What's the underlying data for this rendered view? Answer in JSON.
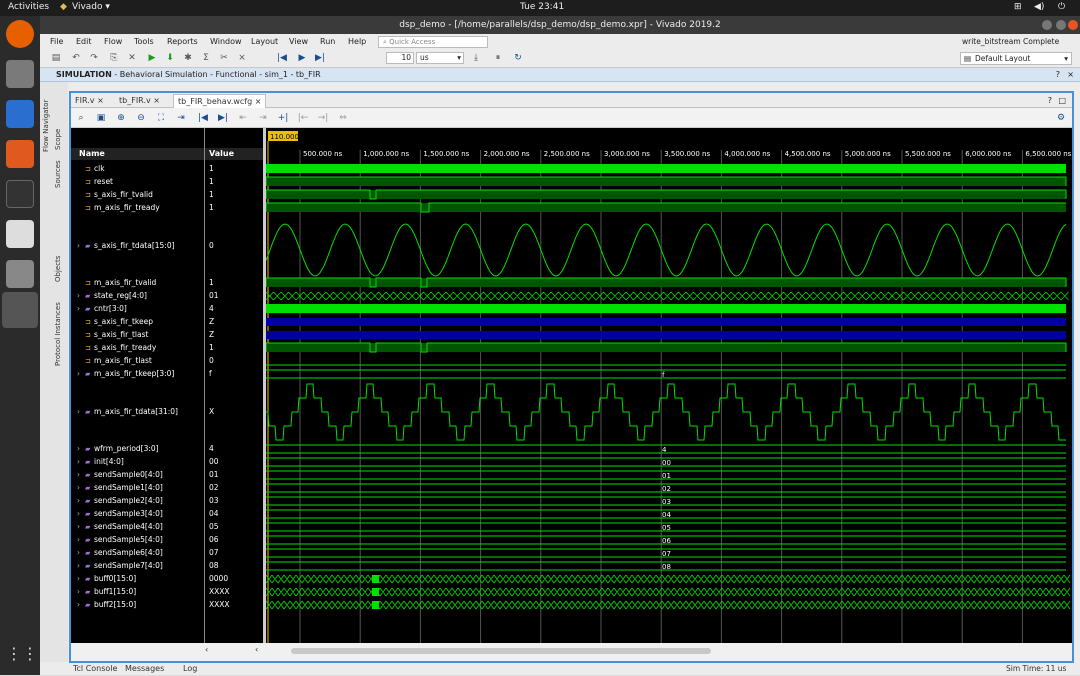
{
  "topbar": {
    "activities": "Activities",
    "app": "Vivado ▾",
    "clock": "Tue 23:41"
  },
  "window": {
    "title": "dsp_demo - [/home/parallels/dsp_demo/dsp_demo.xpr] - Vivado 2019.2"
  },
  "menu": [
    "File",
    "Edit",
    "Flow",
    "Tools",
    "Reports",
    "Window",
    "Layout",
    "View",
    "Run",
    "Help"
  ],
  "quick_access": "Quick Access",
  "toolbar": {
    "run_value": "10",
    "run_unit": "us",
    "status": "write_bitstream Complete",
    "layout": "Default Layout"
  },
  "simbar": {
    "label": "SIMULATION",
    "detail": " - Behavioral Simulation - Functional - sim_1 - tb_FIR"
  },
  "side_tabs": [
    "Flow Navigator",
    "Scope",
    "Sources",
    "Objects",
    "Protocol Instances"
  ],
  "tabs": [
    "FIR.v",
    "tb_FIR.v",
    "tb_FIR_behav.wcfg"
  ],
  "cursor_time": "110.000",
  "columns": {
    "name": "Name",
    "value": "Value"
  },
  "time_ticks": [
    "500.000 ns",
    "1,000.000 ns",
    "1,500.000 ns",
    "2,000.000 ns",
    "2,500.000 ns",
    "3,000.000 ns",
    "3,500.000 ns",
    "4,000.000 ns",
    "4,500.000 ns",
    "5,000.000 ns",
    "5,500.000 ns",
    "6,000.000 ns",
    "6,500.000 ns"
  ],
  "signals": [
    {
      "name": "clk",
      "value": "1",
      "kind": "bit",
      "expand": false
    },
    {
      "name": "reset",
      "value": "1",
      "kind": "bit",
      "expand": false
    },
    {
      "name": "s_axis_fir_tvalid",
      "value": "1",
      "kind": "bit",
      "expand": false
    },
    {
      "name": "m_axis_fir_tready",
      "value": "1",
      "kind": "bit",
      "expand": false
    },
    {
      "name": "s_axis_fir_tdata[15:0]",
      "value": "0",
      "kind": "analog",
      "expand": true
    },
    {
      "name": "m_axis_fir_tvalid",
      "value": "1",
      "kind": "bit",
      "expand": false
    },
    {
      "name": "state_reg[4:0]",
      "value": "01",
      "kind": "bus",
      "expand": true
    },
    {
      "name": "cntr[3:0]",
      "value": "4",
      "kind": "bus",
      "expand": true
    },
    {
      "name": "s_axis_fir_tkeep",
      "value": "Z",
      "kind": "bit",
      "expand": false
    },
    {
      "name": "s_axis_fir_tlast",
      "value": "Z",
      "kind": "bit",
      "expand": false
    },
    {
      "name": "s_axis_fir_tready",
      "value": "1",
      "kind": "bit",
      "expand": false
    },
    {
      "name": "m_axis_fir_tlast",
      "value": "0",
      "kind": "bit",
      "expand": false
    },
    {
      "name": "m_axis_fir_tkeep[3:0]",
      "value": "f",
      "kind": "bus",
      "expand": true
    },
    {
      "name": "m_axis_fir_tdata[31:0]",
      "value": "X",
      "kind": "analog",
      "expand": true
    },
    {
      "name": "wfrm_period[3:0]",
      "value": "4",
      "kind": "bus",
      "expand": true
    },
    {
      "name": "init[4:0]",
      "value": "00",
      "kind": "bus",
      "expand": true
    },
    {
      "name": "sendSample0[4:0]",
      "value": "01",
      "kind": "bus",
      "expand": true
    },
    {
      "name": "sendSample1[4:0]",
      "value": "02",
      "kind": "bus",
      "expand": true
    },
    {
      "name": "sendSample2[4:0]",
      "value": "03",
      "kind": "bus",
      "expand": true
    },
    {
      "name": "sendSample3[4:0]",
      "value": "04",
      "kind": "bus",
      "expand": true
    },
    {
      "name": "sendSample4[4:0]",
      "value": "05",
      "kind": "bus",
      "expand": true
    },
    {
      "name": "sendSample5[4:0]",
      "value": "06",
      "kind": "bus",
      "expand": true
    },
    {
      "name": "sendSample6[4:0]",
      "value": "07",
      "kind": "bus",
      "expand": true
    },
    {
      "name": "sendSample7[4:0]",
      "value": "08",
      "kind": "bus",
      "expand": true
    },
    {
      "name": "buff0[15:0]",
      "value": "0000",
      "kind": "bus",
      "expand": true
    },
    {
      "name": "buff1[15:0]",
      "value": "XXXX",
      "kind": "bus",
      "expand": true
    },
    {
      "name": "buff2[15:0]",
      "value": "XXXX",
      "kind": "bus",
      "expand": true
    }
  ],
  "bottom_tabs": [
    "Tcl Console",
    "Messages",
    "Log"
  ],
  "sim_time": "Sim Time: 11 us",
  "colors": {
    "wave": "#00e000",
    "bg": "#000000",
    "accent": "#4a90d9"
  }
}
